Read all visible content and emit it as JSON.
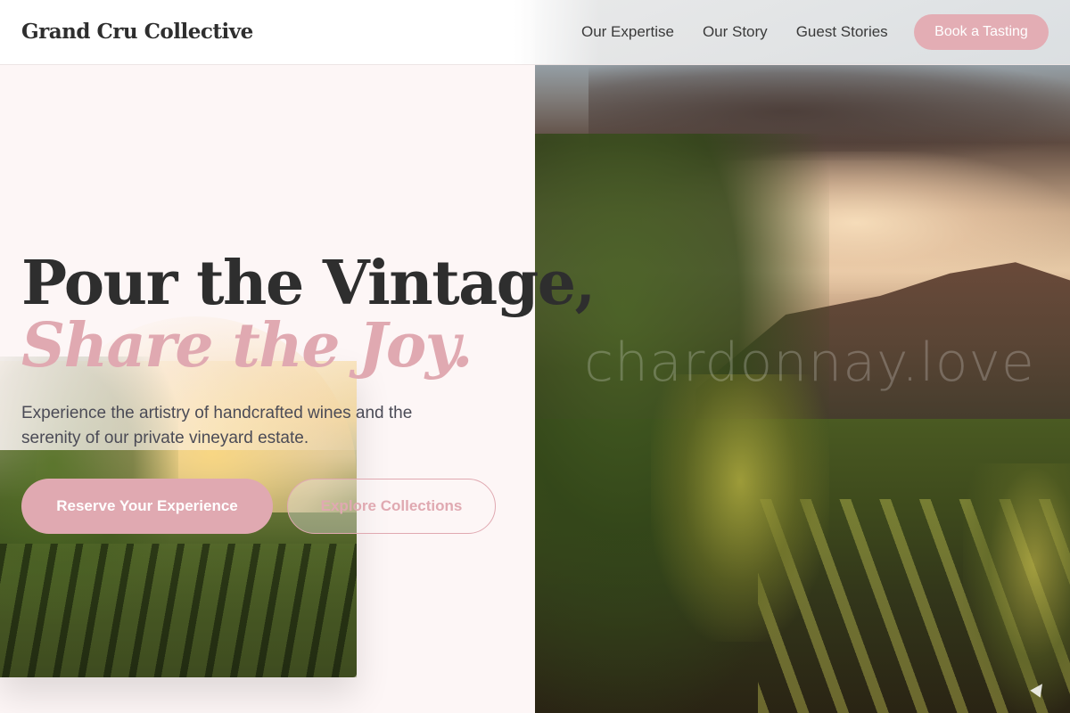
{
  "nav": {
    "logo": "Grand Cru Collective",
    "links": [
      "Our Expertise",
      "Our Story",
      "Guest Stories"
    ],
    "cta": "Book a Tasting"
  },
  "hero": {
    "headline_line1": "Pour the Vintage,",
    "headline_line2": "Share the Joy.",
    "subtext": "Experience the artistry of handcrafted wines and the serenity of our private vineyard estate.",
    "primary_button": "Reserve Your Experience",
    "secondary_button": "Explore Collections",
    "watermark": "chardonnay.love"
  },
  "colors": {
    "accent": "#e0a9b1",
    "heading": "#2e2e2e",
    "body_text": "#4b4b56",
    "background": "#fdf6f6"
  },
  "images": {
    "right_hero": "vineyard-sunset-photo",
    "inset": "vineyard-rows-golden-hour-photo"
  }
}
